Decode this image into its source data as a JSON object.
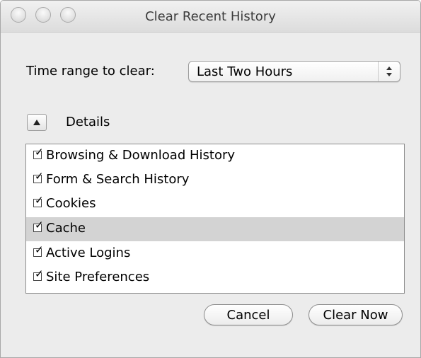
{
  "window": {
    "title": "Clear Recent History"
  },
  "time_range": {
    "label": "Time range to clear:",
    "selected": "Last Two Hours"
  },
  "details": {
    "label": "Details",
    "expanded": true
  },
  "items": [
    {
      "label": "Browsing & Download History",
      "checked": true,
      "selected": false
    },
    {
      "label": "Form & Search History",
      "checked": true,
      "selected": false
    },
    {
      "label": "Cookies",
      "checked": true,
      "selected": false
    },
    {
      "label": "Cache",
      "checked": true,
      "selected": true
    },
    {
      "label": "Active Logins",
      "checked": true,
      "selected": false
    },
    {
      "label": "Site Preferences",
      "checked": true,
      "selected": false
    }
  ],
  "buttons": {
    "cancel": "Cancel",
    "clear_now": "Clear Now"
  }
}
